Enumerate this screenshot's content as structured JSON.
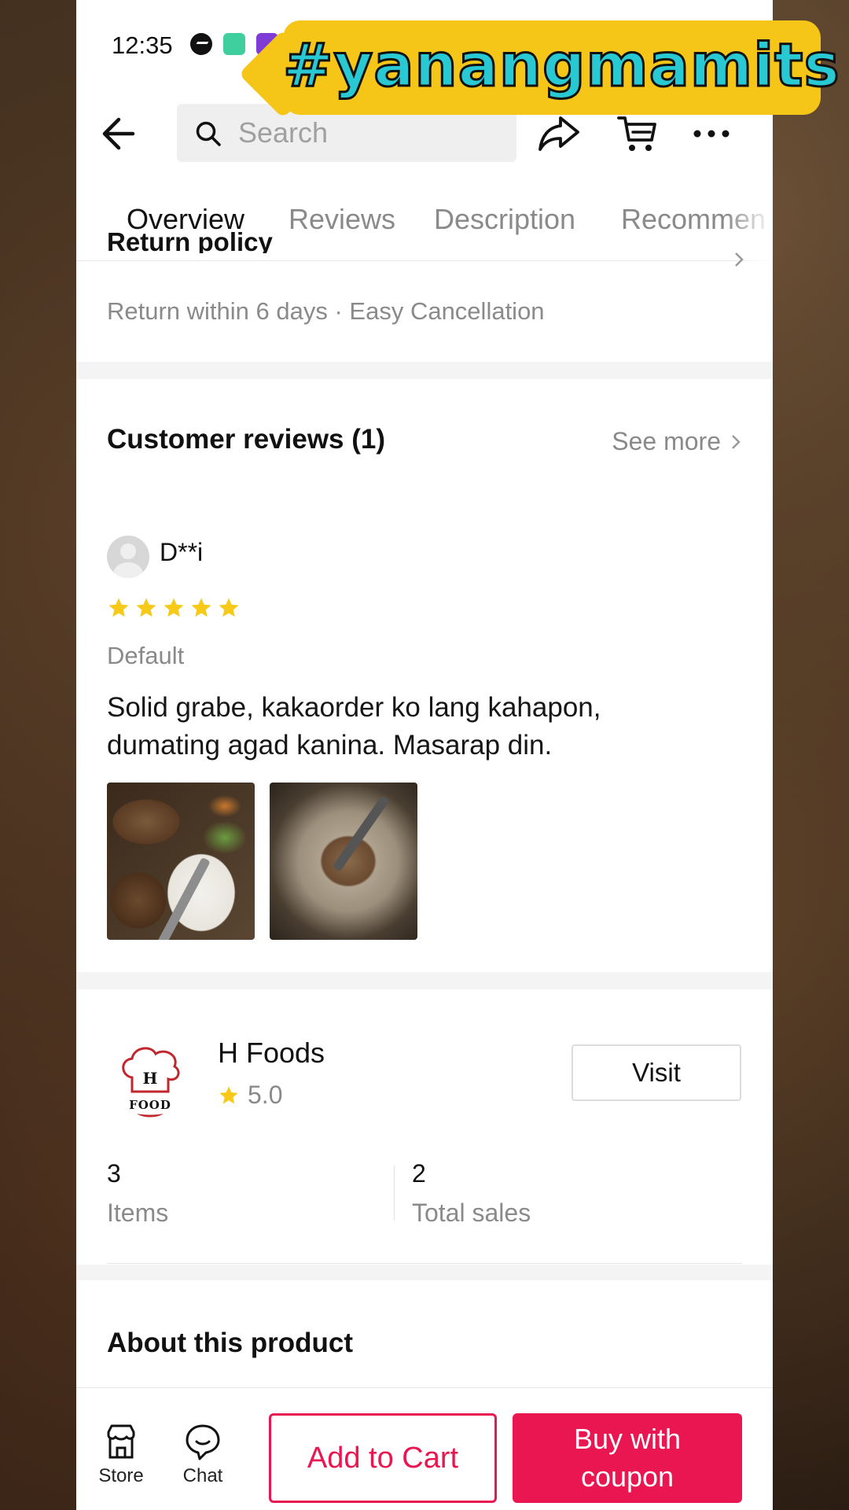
{
  "status_bar": {
    "time": "12:35"
  },
  "overlay": {
    "hashtag": "#yanangmamits"
  },
  "search": {
    "placeholder": "Search"
  },
  "tabs": [
    {
      "label": "Overview",
      "active": true
    },
    {
      "label": "Reviews",
      "active": false
    },
    {
      "label": "Description",
      "active": false
    },
    {
      "label": "Recommen",
      "active": false
    }
  ],
  "return_policy": {
    "title": "Return policy",
    "subtitle": "Return within 6 days · Easy Cancellation"
  },
  "reviews": {
    "heading": "Customer reviews (1)",
    "see_more": "See more",
    "items": [
      {
        "reviewer": "D**i",
        "rating": 5,
        "variant": "Default",
        "text": "Solid grabe, kakaorder ko lang kahapon, dumating agad kanina. Masarap din."
      }
    ]
  },
  "store": {
    "name": "H Foods",
    "rating": "5.0",
    "logo_text_top": "H",
    "logo_text_bottom": "FOOD",
    "visit_label": "Visit",
    "stats": [
      {
        "value": "3",
        "label": "Items"
      },
      {
        "value": "2",
        "label": "Total sales"
      }
    ]
  },
  "about": {
    "heading": "About this product"
  },
  "bottom_bar": {
    "store_label": "Store",
    "chat_label": "Chat",
    "add_to_cart": "Add to Cart",
    "buy_with_coupon": "Buy with coupon"
  },
  "colors": {
    "accent": "#ea1651",
    "star": "#f7c919",
    "hashtag_bg": "#f5c518",
    "hashtag_text": "#29c9d3"
  }
}
